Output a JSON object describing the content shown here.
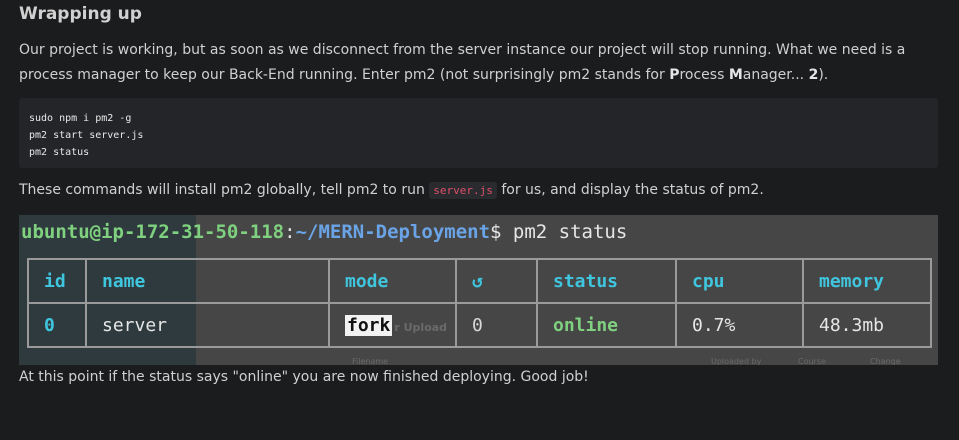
{
  "heading": "Wrapping up",
  "intro": {
    "text1": "Our project is working, but as soon as we disconnect from the server instance our project will stop running. What we need is a process manager to keep our Back-End running. Enter pm2 (not surprisingly pm2 stands for ",
    "bold_p": "P",
    "text2": "rocess ",
    "bold_m": "M",
    "text3": "anager... ",
    "bold_2": "2",
    "text4": ")."
  },
  "code_lines": [
    "sudo npm i pm2 -g",
    "pm2 start server.js",
    "pm2 status"
  ],
  "para2": {
    "before": "These commands will install pm2 globally, tell pm2 to run ",
    "code": "server.js",
    "after": " for us, and display the status of pm2."
  },
  "terminal": {
    "user_host": "ubuntu@ip-172-31-50-118",
    "colon": ":",
    "path": "~/MERN-Deployment",
    "dollar_cmd": "$ pm2 status",
    "headers": [
      "id",
      "name",
      "mode",
      "↺",
      "status",
      "cpu",
      "memory"
    ],
    "row": {
      "id": "0",
      "name": "server",
      "mode": "fork",
      "mode_overlay": "r Upload",
      "restarts": "0",
      "status": "online",
      "cpu": "0.7%",
      "memory": "48.3mb"
    },
    "ghost_labels": [
      "Filename",
      "Uploaded by",
      "Course",
      "Change"
    ]
  },
  "closing": "At this point if the status says \"online\" you are now finished deploying. Good job!"
}
